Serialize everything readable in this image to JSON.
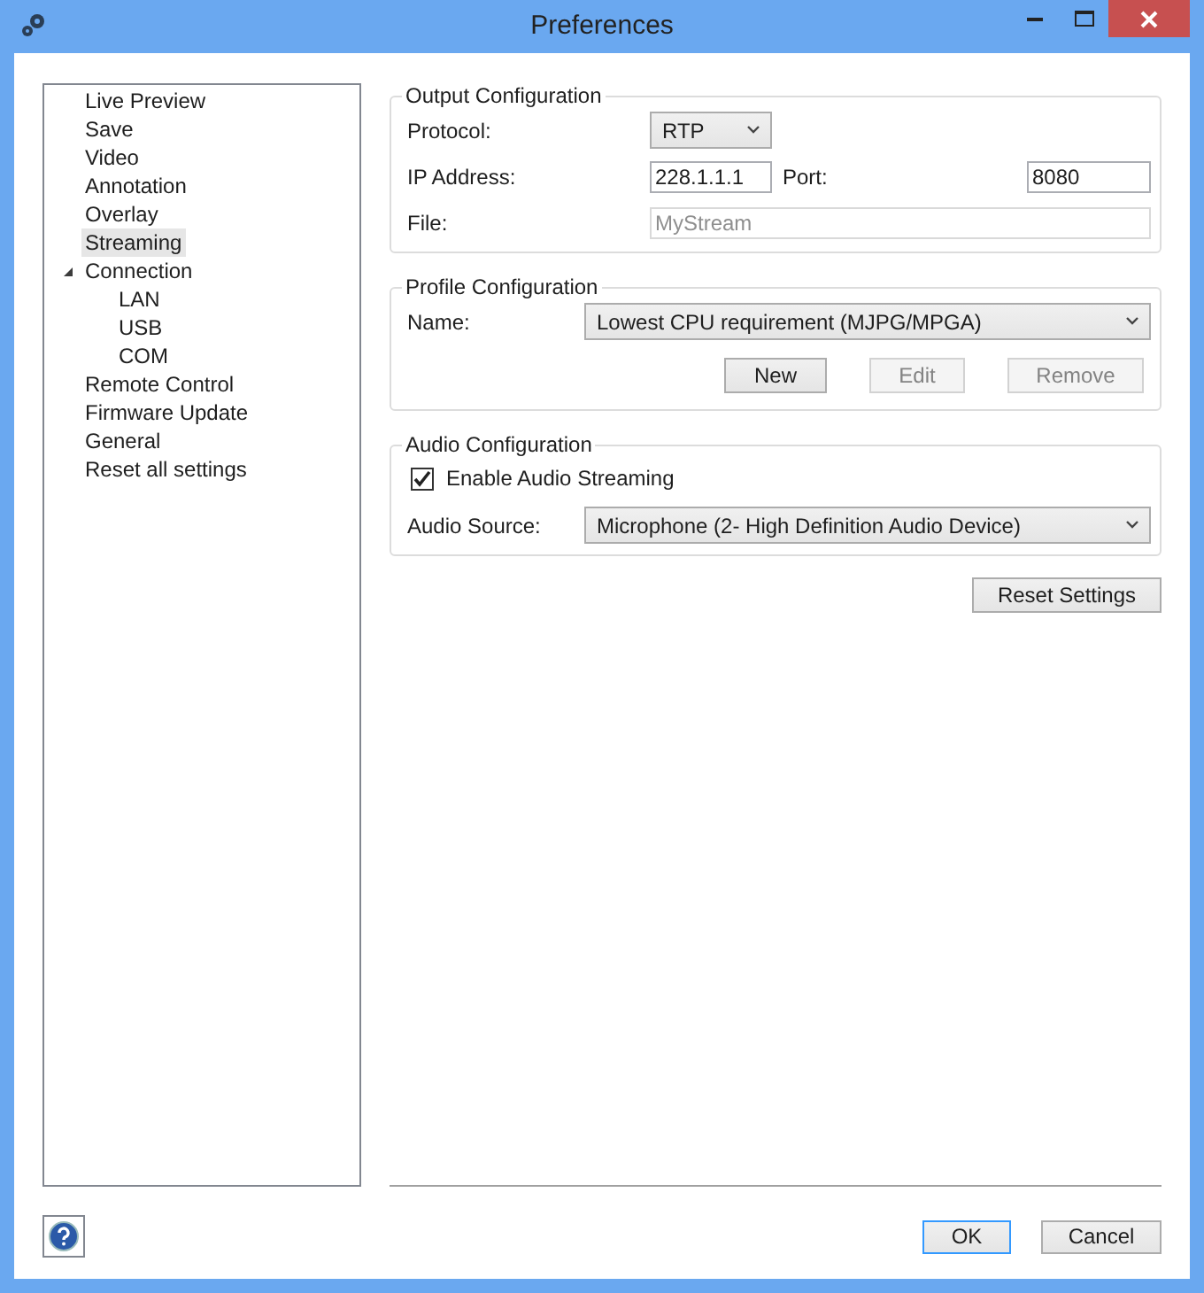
{
  "window": {
    "title": "Preferences"
  },
  "tree": [
    {
      "label": "Live Preview",
      "selected": false
    },
    {
      "label": "Save",
      "selected": false
    },
    {
      "label": "Video",
      "selected": false
    },
    {
      "label": "Annotation",
      "selected": false
    },
    {
      "label": "Overlay",
      "selected": false
    },
    {
      "label": "Streaming",
      "selected": true
    },
    {
      "label": "Connection",
      "selected": false,
      "expanded": true,
      "children": [
        {
          "label": "LAN",
          "selected": false
        },
        {
          "label": "USB",
          "selected": false
        },
        {
          "label": "COM",
          "selected": false
        }
      ]
    },
    {
      "label": "Remote Control",
      "selected": false
    },
    {
      "label": "Firmware Update",
      "selected": false
    },
    {
      "label": "General",
      "selected": false
    },
    {
      "label": "Reset all settings",
      "selected": false
    }
  ],
  "output": {
    "title": "Output Configuration",
    "protocol_label": "Protocol:",
    "protocol": "RTP",
    "ip_label": "IP Address:",
    "ip": "228.1.1.1",
    "port_label": "Port:",
    "port": "8080",
    "file_label": "File:",
    "file": "MyStream",
    "file_disabled": true
  },
  "profile": {
    "title": "Profile Configuration",
    "name_label": "Name:",
    "name": "Lowest CPU requirement (MJPG/MPGA)",
    "buttons": [
      {
        "label": "New",
        "disabled": false
      },
      {
        "label": "Edit",
        "disabled": true
      },
      {
        "label": "Remove",
        "disabled": true
      }
    ]
  },
  "audio": {
    "title": "Audio Configuration",
    "enable_label": "Enable Audio Streaming",
    "enabled": true,
    "source_label": "Audio Source:",
    "source": "Microphone (2- High Definition Audio Device)"
  },
  "reset_button": "Reset Settings",
  "footer": [
    {
      "label": "OK",
      "default": true
    },
    {
      "label": "Cancel",
      "default": false
    }
  ]
}
